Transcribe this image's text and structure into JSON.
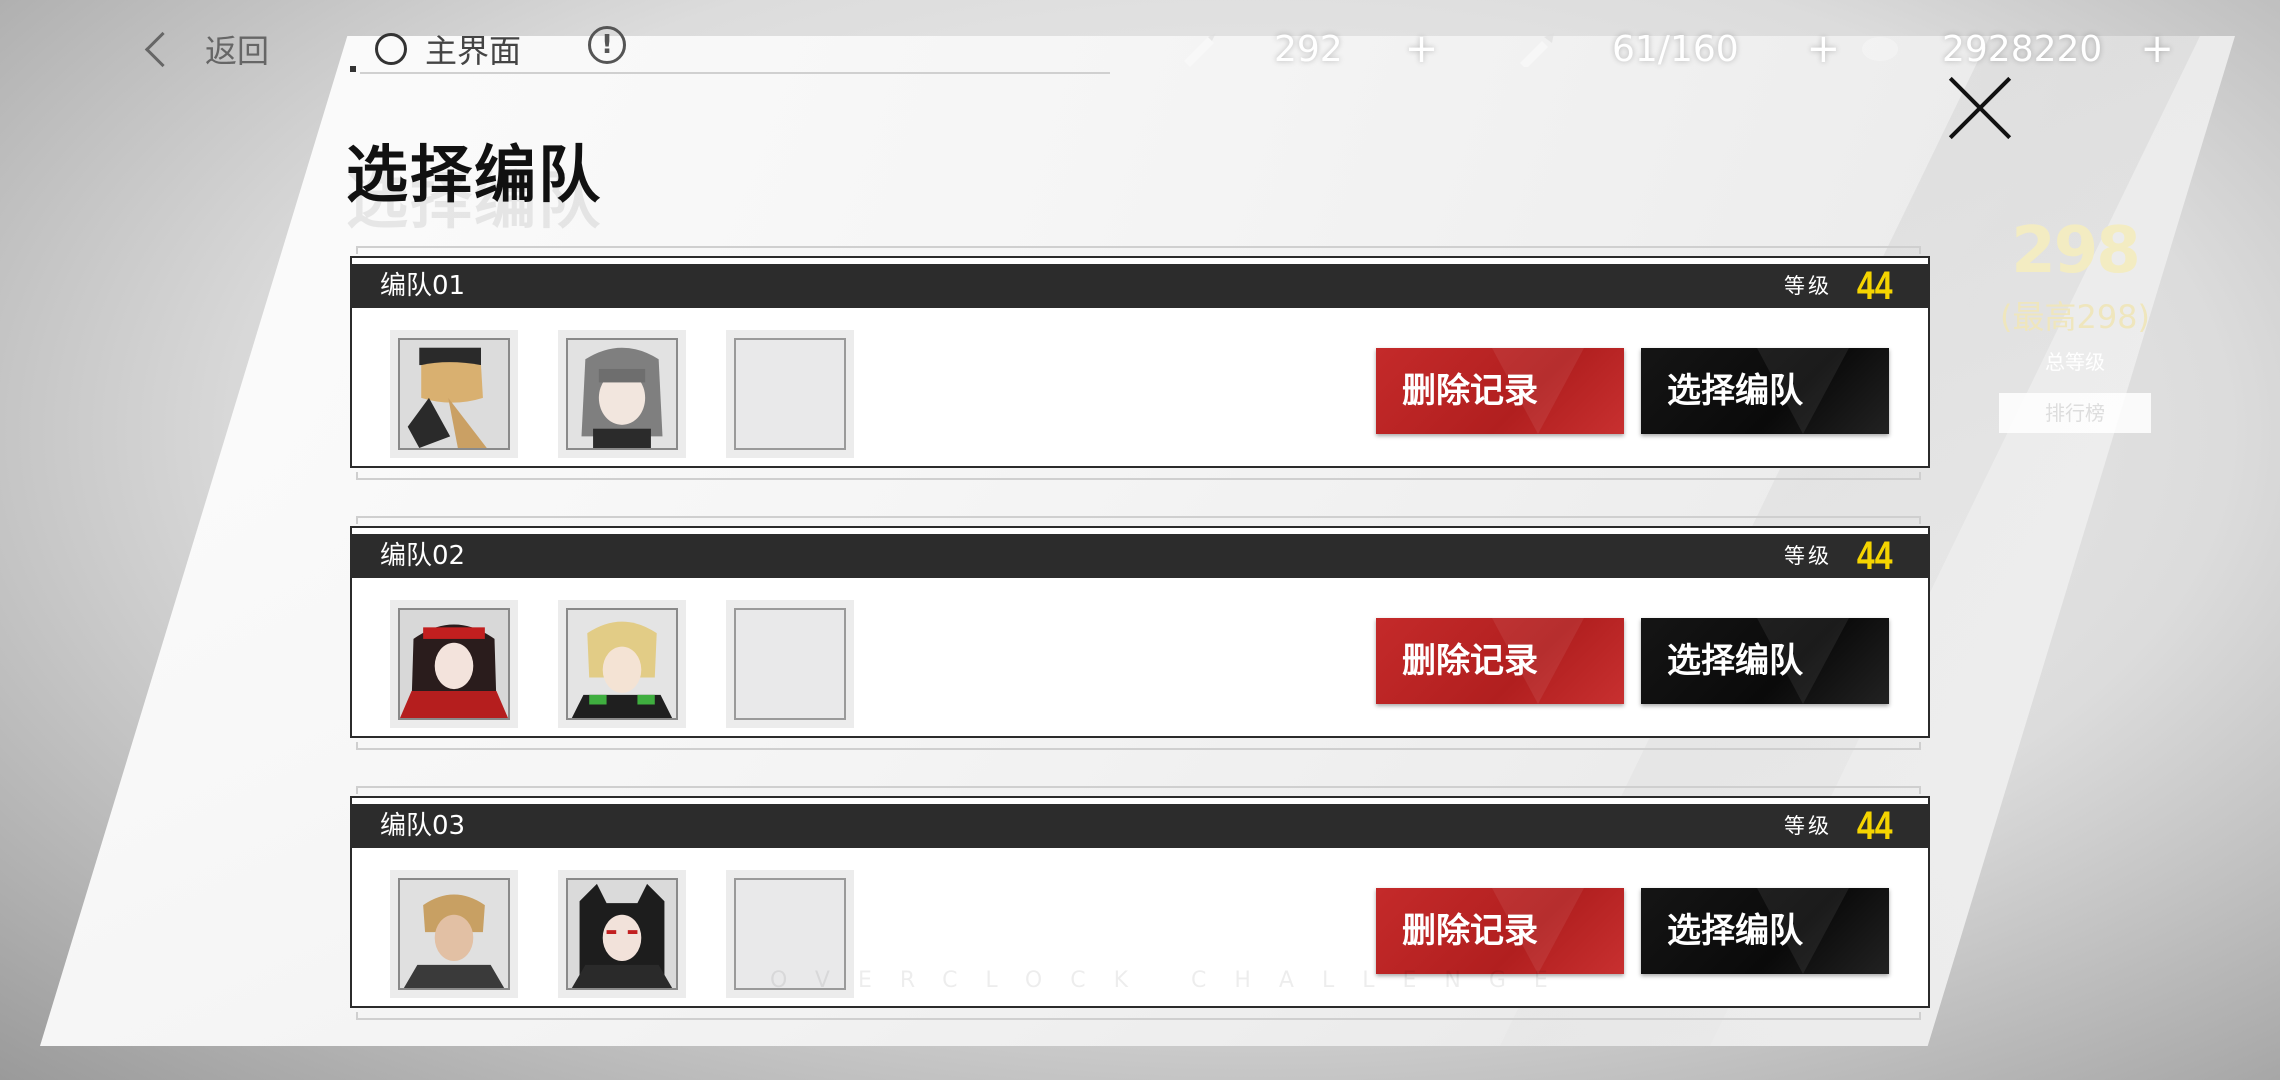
{
  "topbar": {
    "back_label": "返回",
    "home_label": "主界面",
    "resources": [
      {
        "icon": "pen-icon",
        "value": "292",
        "plus": "+"
      },
      {
        "icon": "syringe-icon",
        "value": "61/160",
        "plus": "+"
      },
      {
        "icon": "coin-icon",
        "value": "2928220",
        "plus": "+"
      }
    ]
  },
  "page": {
    "title": "选择编队"
  },
  "ranking": {
    "total": "298",
    "max": "(最高298)",
    "label": "总等级",
    "button": "排行榜"
  },
  "teams": [
    {
      "name": "编队01",
      "level_label": "等级",
      "level": "44",
      "delete_label": "删除记录",
      "select_label": "选择编队"
    },
    {
      "name": "编队02",
      "level_label": "等级",
      "level": "44",
      "delete_label": "删除记录",
      "select_label": "选择编队"
    },
    {
      "name": "编队03",
      "level_label": "等级",
      "level": "44",
      "delete_label": "删除记录",
      "select_label": "选择编队"
    }
  ],
  "watermark": "OVERCLOCK CHALLENGE",
  "colors": {
    "delete": "#c42a2a",
    "select": "#111111",
    "level": "#f5d400"
  }
}
